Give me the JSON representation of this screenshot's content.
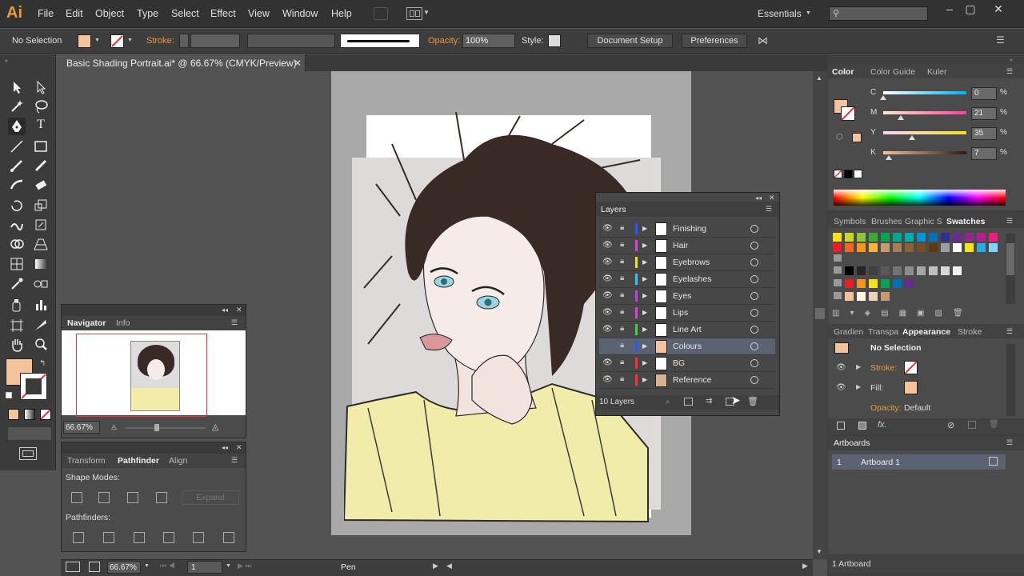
{
  "app": {
    "logo": "Ai"
  },
  "menu": [
    "File",
    "Edit",
    "Object",
    "Type",
    "Select",
    "Effect",
    "View",
    "Window",
    "Help"
  ],
  "workspace": {
    "label": "Essentials",
    "search_placeholder": ""
  },
  "control": {
    "selection": "No Selection",
    "stroke_label": "Stroke:",
    "opacity_label": "Opacity:",
    "opacity_value": "100%",
    "style_label": "Style:",
    "document_setup": "Document Setup",
    "preferences": "Preferences"
  },
  "document": {
    "tab_title": "Basic Shading Portrait.ai* @ 66.67% (CMYK/Preview)"
  },
  "layers": {
    "title": "Layers",
    "items": [
      {
        "name": "Finishing",
        "color": "#2a56ff",
        "visible": true
      },
      {
        "name": "Hair",
        "color": "#e040e0",
        "visible": true
      },
      {
        "name": "Eyebrows",
        "color": "#f0e020",
        "visible": true
      },
      {
        "name": "Eyelashes",
        "color": "#40c0f0",
        "visible": true
      },
      {
        "name": "Eyes",
        "color": "#c040f0",
        "visible": true
      },
      {
        "name": "Lips",
        "color": "#e040e0",
        "visible": true
      },
      {
        "name": "Line Art",
        "color": "#40d040",
        "visible": true
      },
      {
        "name": "Colours",
        "color": "#2a56ff",
        "visible": false,
        "selected": true
      },
      {
        "name": "BG",
        "color": "#ff3030",
        "visible": true
      },
      {
        "name": "Reference",
        "color": "#ff3030",
        "visible": true
      }
    ],
    "count": "10 Layers"
  },
  "navigator": {
    "tabs": [
      "Navigator",
      "Info"
    ],
    "zoom": "66.67%"
  },
  "pathfinder": {
    "tabs": [
      "Transform",
      "Pathfinder",
      "Align"
    ],
    "shape_modes": "Shape Modes:",
    "expand": "Expand",
    "pathfinders": "Pathfinders:"
  },
  "color_panel": {
    "tabs": [
      "Color",
      "Color Guide",
      "Kuler"
    ],
    "channels": [
      {
        "label": "C",
        "value": "0",
        "unit": "%",
        "level": 0.0
      },
      {
        "label": "M",
        "value": "21",
        "unit": "%",
        "level": 0.21
      },
      {
        "label": "Y",
        "value": "35",
        "unit": "%",
        "level": 0.35
      },
      {
        "label": "K",
        "value": "7",
        "unit": "%",
        "level": 0.07
      }
    ],
    "fill_color": "#f3c49c"
  },
  "swatches": {
    "tabs": [
      "Symbols",
      "Brushes",
      "Graphic S",
      "Swatches"
    ],
    "row1": [
      "#f5e11c",
      "#c6d92a",
      "#8cc63f",
      "#3aaa35",
      "#00a651",
      "#00a88f",
      "#00aeae",
      "#0095da",
      "#0072bc",
      "#2e3192",
      "#662d91",
      "#92278f",
      "#b41e8e",
      "#ed1e79"
    ],
    "row2": [
      "#ed1c24",
      "#f26522",
      "#f7941d",
      "#fbb040",
      "#c69c6d",
      "#a67c52",
      "#8c6239",
      "#754c24",
      "#603913",
      "#9e9e9e",
      "#ffffff",
      "#f5e11c",
      "#29abe2",
      "#81d4fa"
    ]
  },
  "appearance": {
    "tabs": [
      "Gradien",
      "Transpa",
      "Appearance",
      "Stroke"
    ],
    "title": "No Selection",
    "stroke": "Stroke:",
    "fill": "Fill:",
    "opacity_label": "Opacity:",
    "opacity_value": "Default"
  },
  "artboards": {
    "title": "Artboards",
    "items": [
      {
        "index": "1",
        "name": "Artboard 1"
      }
    ],
    "count": "1 Artboard"
  },
  "status": {
    "zoom": "66.67%",
    "page": "1",
    "tool": "Pen"
  }
}
